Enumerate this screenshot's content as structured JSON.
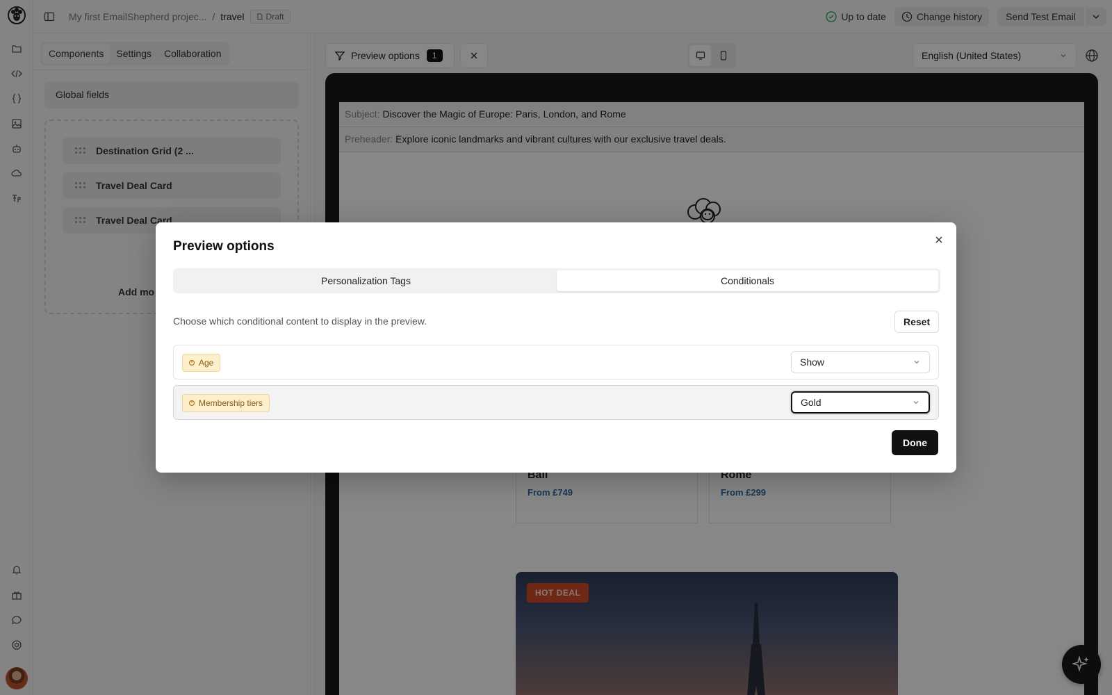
{
  "topbar": {
    "breadcrumb_project": "My first EmailShepherd projec...",
    "breadcrumb_separator": "/",
    "breadcrumb_current": "travel",
    "draft_badge": "Draft",
    "status": "Up to date",
    "change_history": "Change history",
    "send_test_email": "Send Test Email"
  },
  "left_panel": {
    "tabs": [
      "Components",
      "Settings",
      "Collaboration"
    ],
    "global_fields": "Global fields",
    "components": [
      "Destination Grid (2 ...",
      "Travel Deal Card",
      "Travel Deal Card"
    ],
    "add_more": "Add mo"
  },
  "preview_toolbar": {
    "preview_options_label": "Preview options",
    "preview_options_count": "1",
    "language": "English (United States)"
  },
  "email": {
    "subject_key": "Subject:",
    "subject": "Discover the Magic of Europe: Paris, London, and Rome",
    "preheader_key": "Preheader:",
    "preheader": "Explore iconic landmarks and vibrant cultures with our exclusive travel deals.",
    "cards": [
      {
        "city": "Bali",
        "price": "From £749"
      },
      {
        "city": "Rome",
        "price": "From £299"
      }
    ],
    "hot_deal": "HOT DEAL"
  },
  "modal": {
    "title": "Preview options",
    "tabs": [
      "Personalization Tags",
      "Conditionals"
    ],
    "active_tab": "Conditionals",
    "description": "Choose which conditional content to display in the preview.",
    "reset_label": "Reset",
    "conditions": [
      {
        "tag": "Age",
        "value": "Show"
      },
      {
        "tag": "Membership tiers",
        "value": "Gold"
      }
    ],
    "done_label": "Done"
  },
  "colors": {
    "tag_bg": "#fbefcc",
    "tag_text": "#8a5a12",
    "hot_deal": "#d24a2b",
    "price": "#2f6b9f",
    "primary_button": "#111111"
  }
}
